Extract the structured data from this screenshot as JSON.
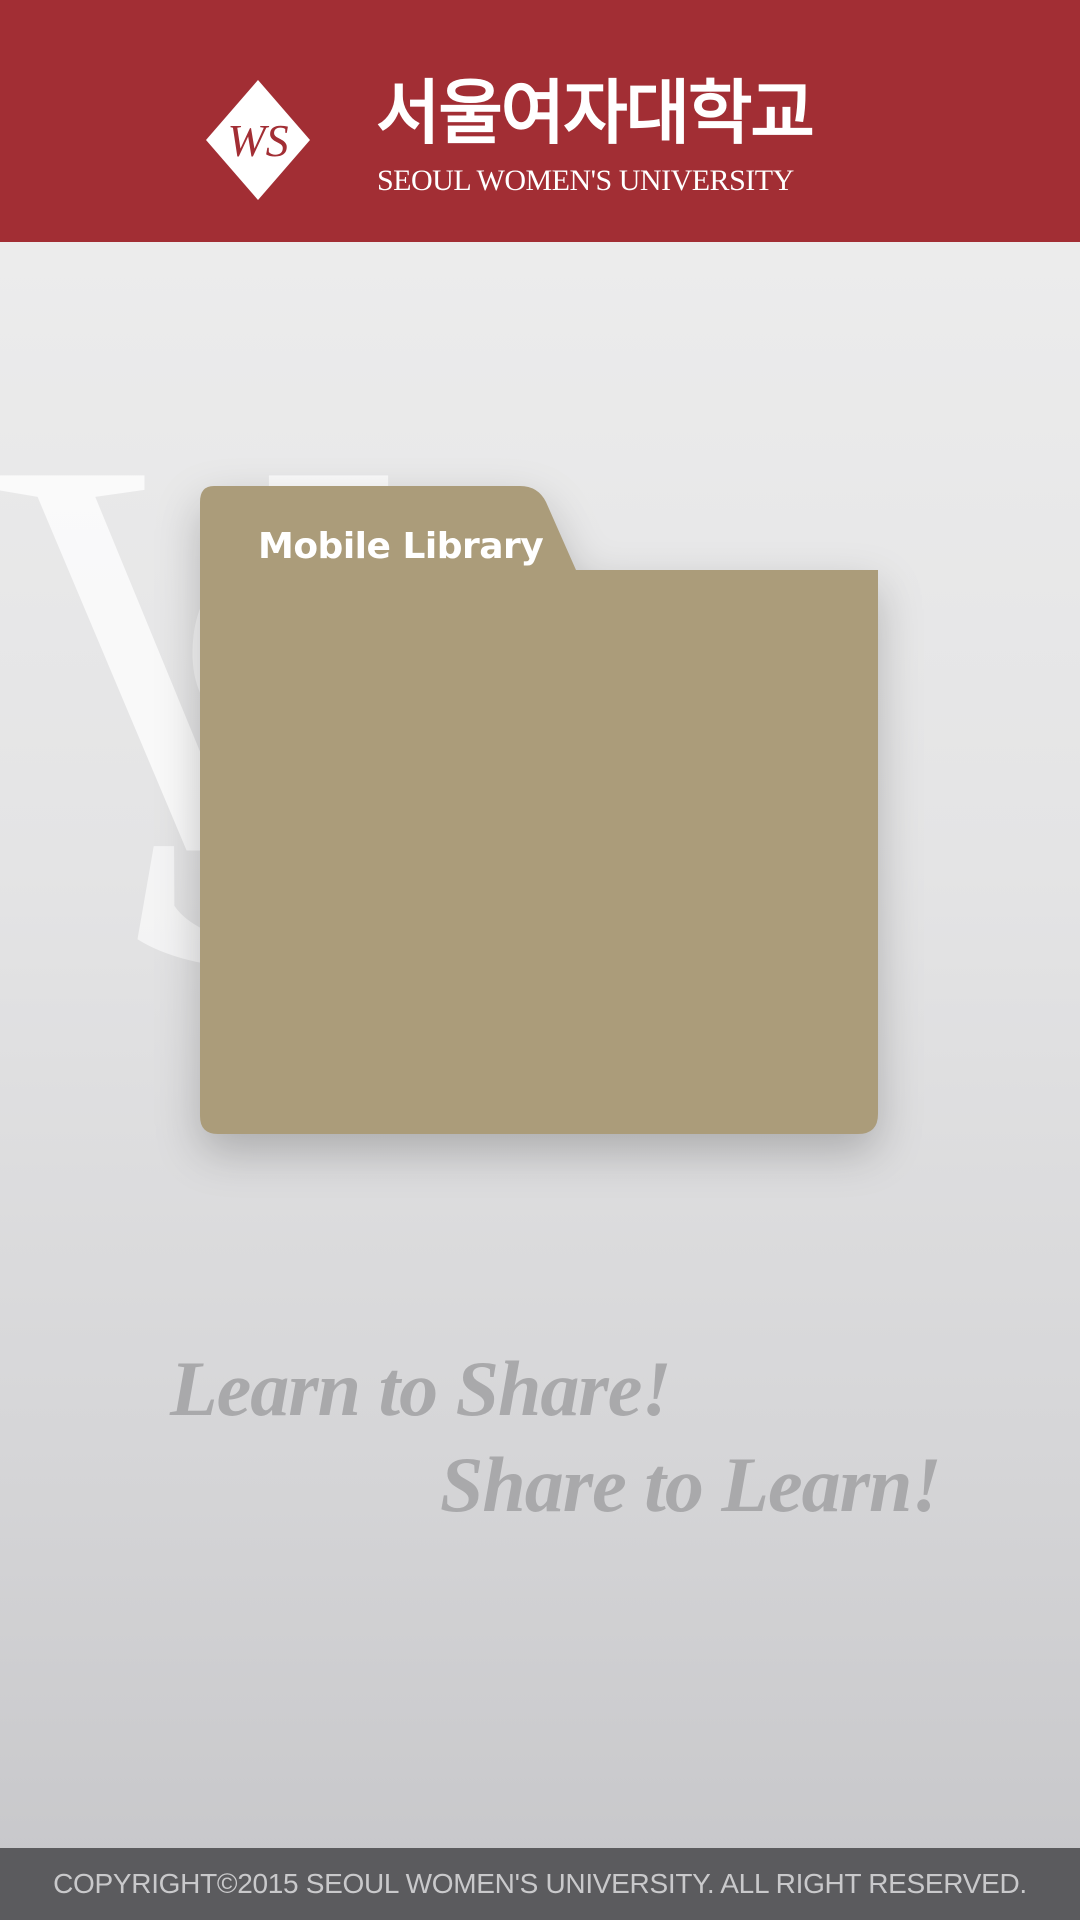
{
  "header": {
    "title_korean": "서울여자대학교",
    "title_english": "SEOUL WOMEN'S UNIVERSITY",
    "logo_mark_text": "WS",
    "background_color": "#a22e34"
  },
  "main": {
    "folder": {
      "label": "Mobile Library",
      "icon": "folder-icon",
      "color": "#ab9c7a"
    },
    "slogan": {
      "line1": "Learn to Share!",
      "line2": "Share to Learn!"
    }
  },
  "footer": {
    "copyright": "COPYRIGHT©2015 SEOUL WOMEN'S UNIVERSITY. ALL RIGHT RESERVED."
  }
}
